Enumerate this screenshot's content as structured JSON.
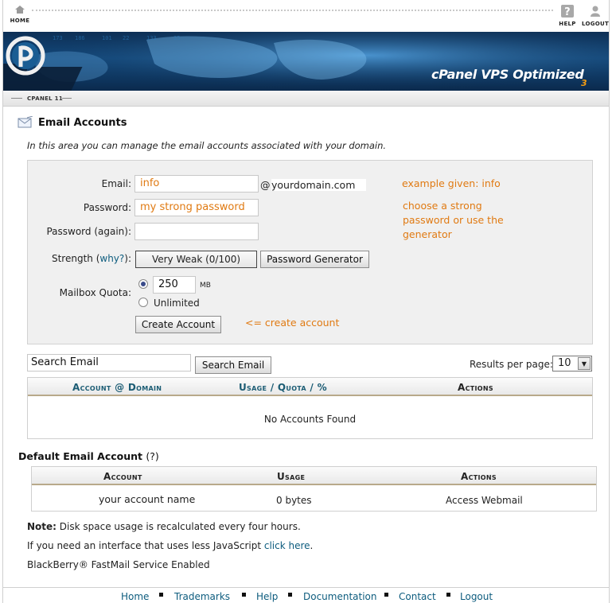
{
  "topnav": {
    "home_label": "HOME",
    "help_label": "HELP",
    "logout_label": "LOGOUT"
  },
  "banner": {
    "brand": "cPanel",
    "brand_suffix": "VPS Optimized",
    "version": "3",
    "accent_color": "#f39c12"
  },
  "subbar": {
    "label": "CPANEL 11"
  },
  "page": {
    "title": "Email Accounts",
    "intro": "In this area you can manage the email accounts associated with your domain."
  },
  "form": {
    "email_label": "Email:",
    "email_value": "info",
    "at_sign": "@",
    "domain": "yourdomain.com",
    "password_label": "Password:",
    "password_value": "my strong password",
    "password_again_label": "Password (again):",
    "password_again_value": "",
    "strength_label": "Strength (",
    "strength_why": "why?",
    "strength_close": "):",
    "strength_value": "Very Weak (0/100)",
    "password_generator": "Password Generator",
    "quota_label": "Mailbox Quota:",
    "quota_value": "250",
    "quota_unit": "MB",
    "unlimited_label": "Unlimited",
    "create_button": "Create Account",
    "note_email": "example given: info",
    "note_password_1": "choose a strong",
    "note_password_2": "password or use the",
    "note_password_3": "generator",
    "note_create": "<= create account",
    "annotation_color": "#e07a12"
  },
  "search": {
    "value": "Search Email",
    "button": "Search Email",
    "rpp_label": "Results per page:",
    "rpp_value": "10"
  },
  "accounts_table": {
    "col_account": "Account",
    "col_at": "@",
    "col_domain": "Domain",
    "col_usage": "Usage",
    "col_slash": "/",
    "col_quota": "Quota",
    "col_pct": "/ %",
    "col_actions": "Actions",
    "empty_text": "No Accounts Found"
  },
  "default_account": {
    "title": "Default Email Account",
    "help": "(?)",
    "col_account": "Account",
    "col_usage": "Usage",
    "col_actions": "Actions",
    "row_account": "your account name",
    "row_usage": "0 bytes",
    "row_action": "Access Webmail"
  },
  "notes": {
    "note_bold": "Note:",
    "note_text": " Disk space usage is recalculated every four hours.",
    "js_text": "If you need an interface that uses less JavaScript ",
    "js_link": "click here",
    "js_end": ".",
    "blackberry": "BlackBerry® FastMail Service Enabled"
  },
  "footer": {
    "home": "Home",
    "trademarks": "Trademarks",
    "help": "Help",
    "documentation": "Documentation",
    "contact": "Contact",
    "logout": "Logout"
  }
}
